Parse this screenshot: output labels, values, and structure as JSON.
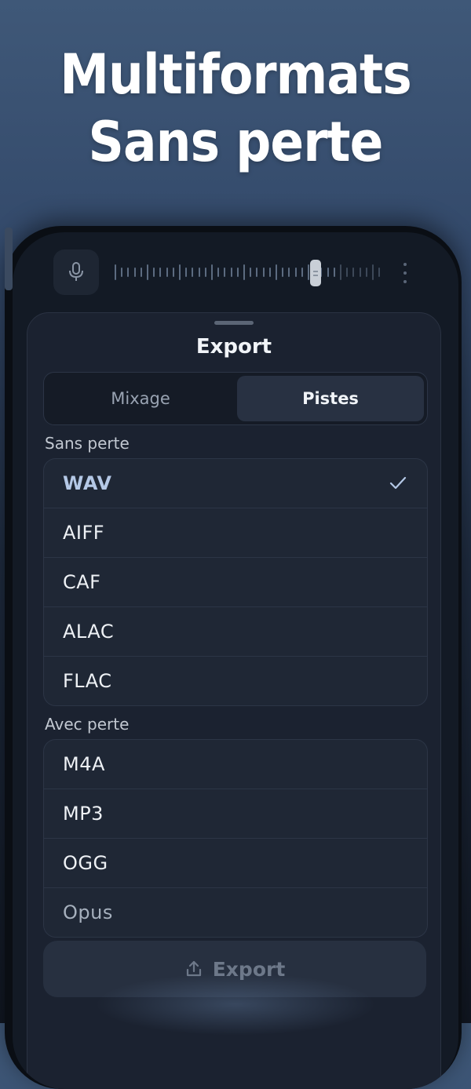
{
  "headline": {
    "line1": "Multiformats",
    "line2": "Sans perte"
  },
  "recorder": {
    "mic_icon": "microphone-icon",
    "more_icon": "more-vertical-icon"
  },
  "sheet": {
    "title": "Export",
    "tabs": [
      {
        "label": "Mixage",
        "selected": false
      },
      {
        "label": "Pistes",
        "selected": true
      }
    ],
    "lossless": {
      "label": "Sans perte",
      "items": [
        "WAV",
        "AIFF",
        "CAF",
        "ALAC",
        "FLAC"
      ],
      "selected": "WAV"
    },
    "lossy": {
      "label": "Avec perte",
      "items": [
        "M4A",
        "MP3",
        "OGG",
        "Opus"
      ]
    },
    "export_button": {
      "label": "Export",
      "icon": "share-upload-icon"
    }
  },
  "colors": {
    "selected_text": "#b4c8e6",
    "sheet_background": "#1b2230"
  }
}
